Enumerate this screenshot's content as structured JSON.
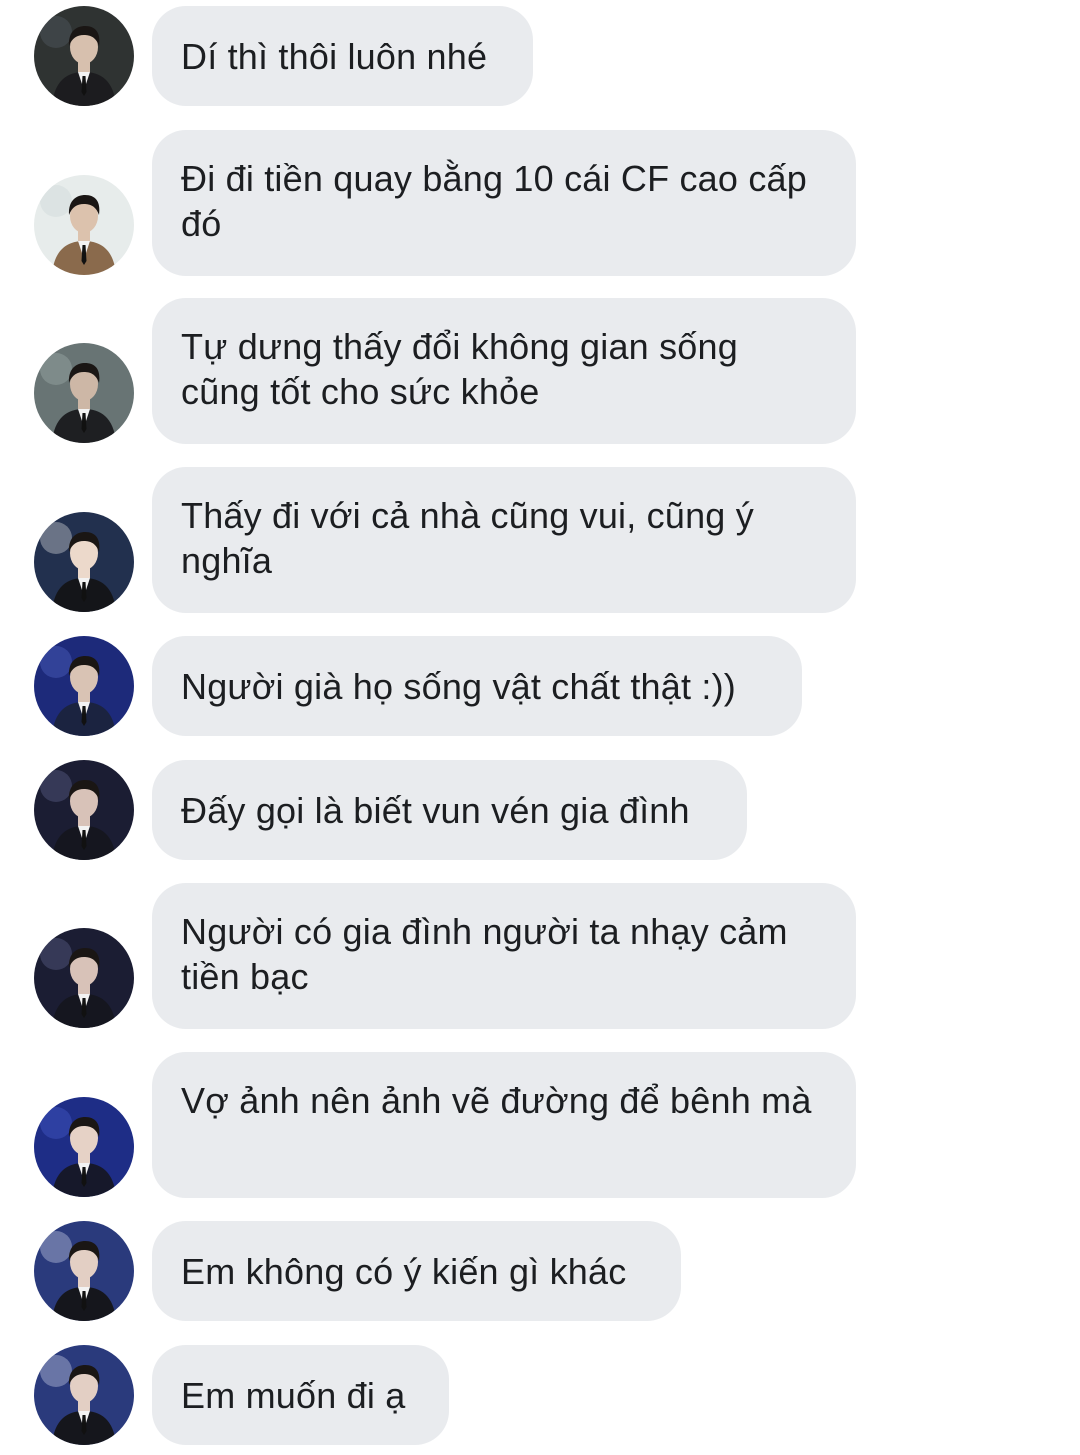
{
  "messages": [
    {
      "text": "Dí thì thôi luôn nhé",
      "avatar": {
        "bg": "#2f3332",
        "skin": "#d7c0ae",
        "suit": "#1c1c1f",
        "accent": "#5b6470"
      }
    },
    {
      "text": "Đi đi tiền quay bằng 10 cái CF cao cấp đó",
      "avatar": {
        "bg": "#e7eceb",
        "skin": "#dcc2ad",
        "suit": "#8a6a4c",
        "accent": "#c9d4d4"
      }
    },
    {
      "text": "Tự dưng thấy đổi không gian sống cũng tốt cho sức khỏe",
      "avatar": {
        "bg": "#687474",
        "skin": "#cdb7a6",
        "suit": "#1e1f22",
        "accent": "#a9b7b5"
      }
    },
    {
      "text": "Thấy đi với cả nhà cũng vui, cũng ý nghĩa",
      "avatar": {
        "bg": "#22304e",
        "skin": "#ecd9cb",
        "suit": "#141519",
        "accent": "#f2f2f2"
      }
    },
    {
      "text": "Người già họ sống vật chất thật :))",
      "avatar": {
        "bg": "#1d2a7a",
        "skin": "#d9c3b4",
        "suit": "#1b2340",
        "accent": "#5c6fd0"
      }
    },
    {
      "text": "Đấy gọi là biết vun vén gia đình",
      "avatar": {
        "bg": "#1b1d33",
        "skin": "#d8c2b8",
        "suit": "#15161f",
        "accent": "#6a6f9c"
      }
    },
    {
      "text": "Người có gia đình người ta nhạy cảm tiền bạc",
      "avatar": {
        "bg": "#1b1d33",
        "skin": "#d8c2b8",
        "suit": "#15161f",
        "accent": "#6a6f9c"
      }
    },
    {
      "text": "Vợ ảnh nên ảnh vẽ đường để bênh mà",
      "avatar": {
        "bg": "#1e2d86",
        "skin": "#e6d2c6",
        "suit": "#16182a",
        "accent": "#4d63d6"
      }
    },
    {
      "text": "Em không có ý kiến gì khác",
      "avatar": {
        "bg": "#2a3a7c",
        "skin": "#e3cfc4",
        "suit": "#15161c",
        "accent": "#dfe6f5"
      }
    },
    {
      "text": "Em muốn đi ạ",
      "avatar": {
        "bg": "#2a3a7c",
        "skin": "#e3cfc4",
        "suit": "#15161c",
        "accent": "#dfe6f5"
      }
    }
  ]
}
